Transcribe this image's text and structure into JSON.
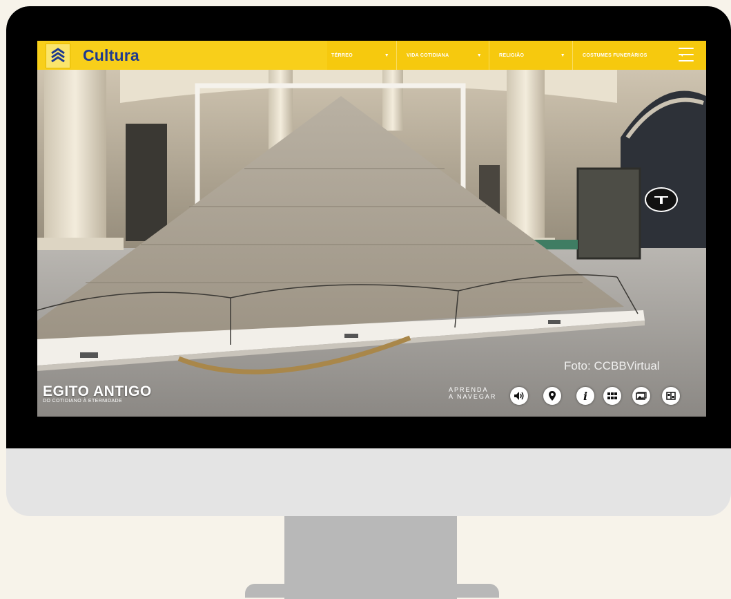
{
  "header": {
    "brand": "Cultura",
    "nav": [
      {
        "label": "TÉRREO"
      },
      {
        "label": "VIDA COTIDIANA"
      },
      {
        "label": "RELIGIÃO"
      },
      {
        "label": "COSTUMES FUNERÁRIOS"
      }
    ]
  },
  "overlay": {
    "photo_credit": "Foto: CCBBVirtual",
    "exhibit_title": "EGITO ANTIGO",
    "exhibit_subtitle": "DO COTIDIANO À ETERNIDADE",
    "learn_line1": "APRENDA",
    "learn_line2": "A NAVEGAR"
  },
  "icons": [
    "bank-logo-icon",
    "menu-icon",
    "sound-icon",
    "map-pin-icon",
    "info-icon",
    "grid-icon",
    "gallery-icon",
    "split-view-icon",
    "hotspot-arrow-icon"
  ],
  "colors": {
    "accent": "#f6c90e",
    "brand": "#1f3a8f"
  }
}
